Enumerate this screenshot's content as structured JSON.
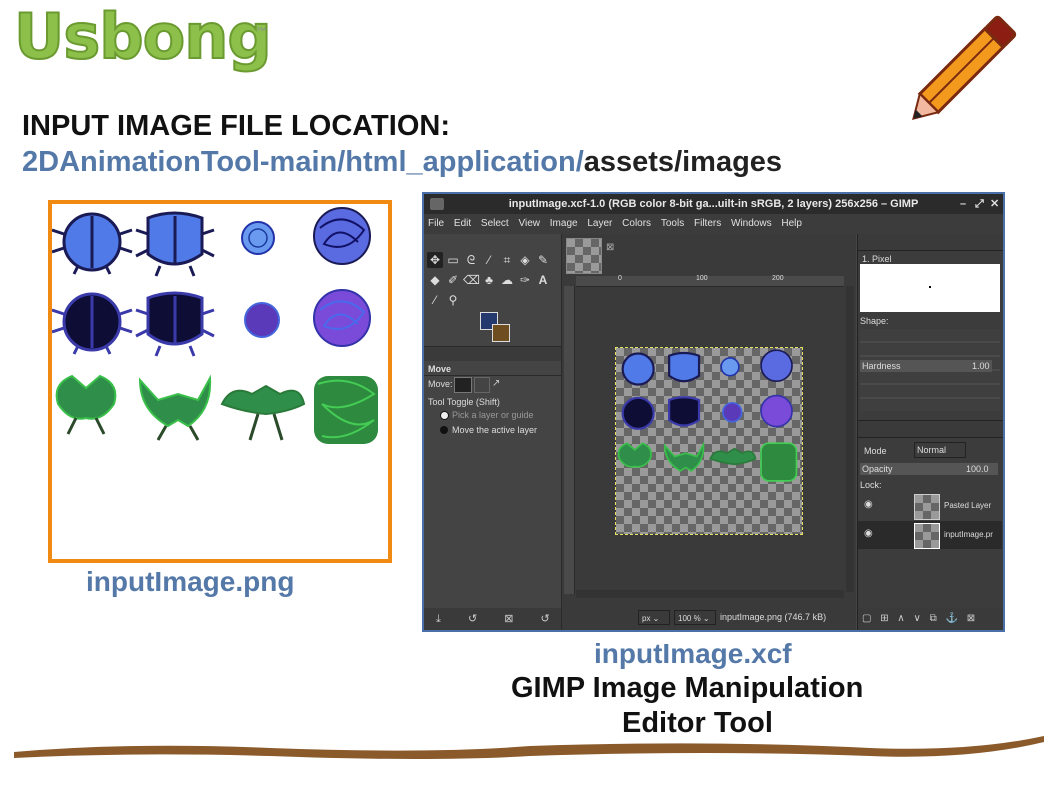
{
  "logo": {
    "text": "Usbong",
    "tm": "™"
  },
  "heading": "INPUT IMAGE FILE LOCATION:",
  "path": {
    "blue_part": "2DAnimationTool-main/html_application/",
    "dark_part": "assets/images"
  },
  "captions": {
    "png": "inputImage.png",
    "xcf": "inputImage.xcf",
    "gimp_line1": "GIMP Image Manipulation",
    "gimp_line2": "Editor Tool"
  },
  "gimp": {
    "title": "inputImage.xcf-1.0 (RGB color 8-bit ga...uilt-in sRGB, 2 layers) 256x256 – GIMP",
    "menu": [
      "File",
      "Edit",
      "Select",
      "View",
      "Image",
      "Layer",
      "Colors",
      "Tools",
      "Filters",
      "Windows",
      "Help"
    ],
    "tool_options": {
      "title": "Move",
      "move_label": "Move:",
      "toggle_label": "Tool Toggle  (Shift)",
      "option1": "Pick a layer or guide",
      "option2": "Move the active layer"
    },
    "brush": {
      "name": "1. Pixel",
      "shape_label": "Shape:",
      "hardness_label": "Hardness",
      "hardness_value": "1.00"
    },
    "layers": {
      "mode_label": "Mode",
      "mode_value": "Normal",
      "opacity_label": "Opacity",
      "opacity_value": "100.0",
      "lock_label": "Lock:",
      "items": [
        "Pasted Layer",
        "inputImage.pr"
      ]
    },
    "status": {
      "unit": "px",
      "zoom": "100 %",
      "file": "inputImage.png (746.7 kB)"
    },
    "ruler": {
      "marks": [
        "0",
        "100",
        "200"
      ]
    }
  },
  "colors": {
    "accent_orange": "#f08a12",
    "caption_blue": "#5479a8",
    "stroke_brown": "#8b5a2b",
    "logo_green": "#8cc04a"
  }
}
